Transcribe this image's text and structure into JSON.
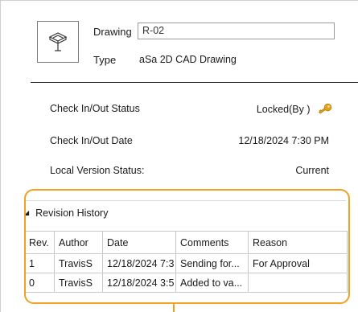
{
  "properties": {
    "drawing_label": "Drawing",
    "drawing_value": "R-02",
    "type_label": "Type",
    "type_value": "aSa 2D CAD Drawing",
    "thumbnail_icon": "cad-drawing-icon"
  },
  "status": {
    "checkinout_status_label": "Check In/Out Status",
    "checkinout_status_value": "Locked(By )",
    "status_icon": "key-icon",
    "checkinout_date_label": "Check In/Out Date",
    "checkinout_date_value": "12/18/2024 7:30 PM",
    "local_version_label": "Local Version Status:",
    "local_version_value": "Current"
  },
  "revision_history": {
    "title": "Revision History",
    "expanded": true,
    "columns": [
      "Rev.",
      "Author",
      "Date",
      "Comments",
      "Reason"
    ],
    "rows": [
      {
        "rev": "1",
        "author": "TravisS",
        "date": "12/18/2024 7:3",
        "comments": "Sending for...",
        "reason": "For Approval"
      },
      {
        "rev": "0",
        "author": "TravisS",
        "date": "12/18/2024 3:5",
        "comments": "Added to va...",
        "reason": ""
      }
    ]
  },
  "colors": {
    "highlight": "#f0a023",
    "key": "#e8a317"
  }
}
